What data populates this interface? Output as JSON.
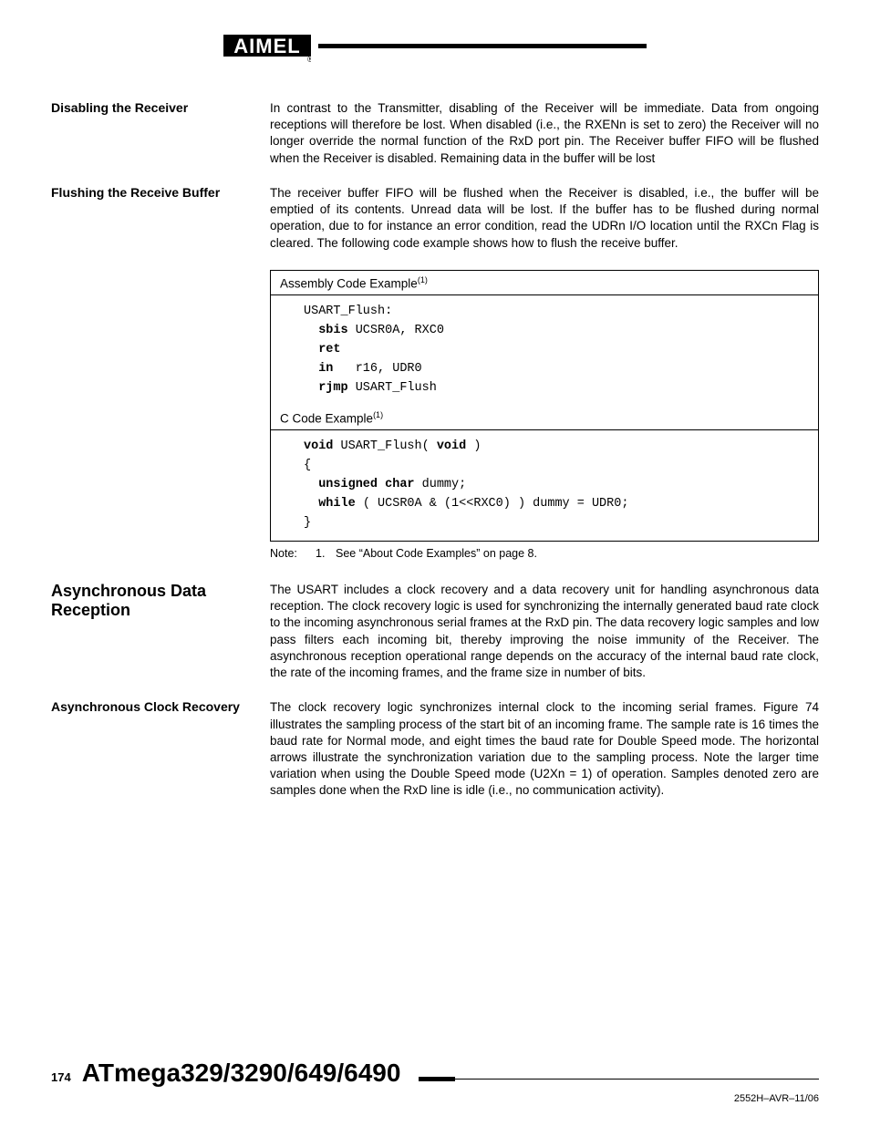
{
  "logo_alt": "Atmel",
  "sections": {
    "disabling_receiver": {
      "heading": "Disabling the Receiver",
      "body": "In contrast to the Transmitter, disabling of the Receiver will be immediate. Data from ongoing receptions will therefore be lost. When disabled (i.e., the RXENn is set to zero) the Receiver will no longer override the normal function of the RxD port pin. The Receiver buffer FIFO will be flushed when the Receiver is disabled. Remaining data in the buffer will be lost"
    },
    "flushing_buffer": {
      "heading": "Flushing the Receive Buffer",
      "body": "The receiver buffer FIFO will be flushed when the Receiver is disabled, i.e., the buffer will be emptied of its contents. Unread data will be lost. If the buffer has to be flushed during normal operation, due to for instance an error condition, read the UDRn I/O location until the RXCn Flag is cleared. The following code example shows how to flush the receive buffer."
    },
    "async_data": {
      "heading": "Asynchronous Data Reception",
      "body": "The USART includes a clock recovery and a data recovery unit for handling asynchronous data reception. The clock recovery logic is used for synchronizing the internally generated baud rate clock to the incoming asynchronous serial frames at the RxD pin. The data recovery logic samples and low pass filters each incoming bit, thereby improving the noise immunity of the Receiver. The asynchronous reception operational range depends on the accuracy of the internal baud rate clock, the rate of the incoming frames, and the frame size in number of bits."
    },
    "async_clock": {
      "heading": "Asynchronous Clock Recovery",
      "body": "The clock recovery logic synchronizes internal clock to the incoming serial frames. Figure 74 illustrates the sampling process of the start bit of an incoming frame. The sample rate is 16 times the baud rate for Normal mode, and eight times the baud rate for Double Speed mode. The horizontal arrows illustrate the synchronization variation due to the sampling process. Note the larger time variation when using the Double Speed mode (U2Xn = 1) of operation. Samples denoted zero are samples done when the RxD line is idle (i.e., no communication activity)."
    }
  },
  "code": {
    "asm_title": "Assembly Code Example",
    "asm_sup": "(1)",
    "asm_lines": {
      "l1": "USART_Flush:",
      "l2a": "sbis",
      "l2b": " UCSR0A, RXC0",
      "l3": "ret",
      "l4a": "in",
      "l4b": "   r16, UDR0",
      "l5a": "rjmp",
      "l5b": " USART_Flush"
    },
    "c_title": "C Code Example",
    "c_sup": "(1)",
    "c_lines": {
      "l1a": "void",
      "l1b": " USART_Flush( ",
      "l1c": "void",
      "l1d": " )",
      "l2": "{",
      "l3a": "unsigned char",
      "l3b": " dummy;",
      "l4a": "while",
      "l4b": " ( UCSR0A & (1<<RXC0) ) dummy = UDR0;",
      "l5": "}"
    }
  },
  "note": {
    "label": "Note:",
    "num": "1.",
    "text": "See “About Code Examples” on page 8."
  },
  "footer": {
    "page": "174",
    "title": "ATmega329/3290/649/6490",
    "doccode": "2552H–AVR–11/06"
  }
}
